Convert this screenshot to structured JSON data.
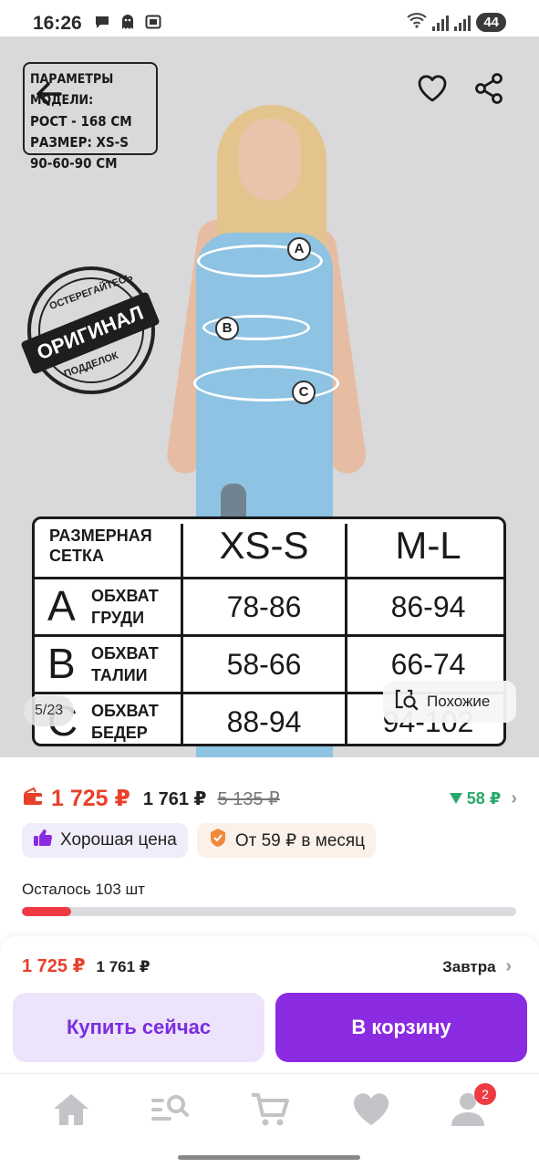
{
  "status_bar": {
    "time": "16:26",
    "battery": "44",
    "icons": [
      "chat-bubble-icon",
      "ghost-icon",
      "screenshot-icon",
      "wifi-icon",
      "signal-icon",
      "signal-roaming-icon"
    ]
  },
  "gallery": {
    "model_params": {
      "title": "ПАРАМЕТРЫ МОДЕЛИ:",
      "height": "РОСТ - 168 СМ",
      "size": "РАЗМЕР: XS-S",
      "measurements": "90-60-90 СМ"
    },
    "stamp": {
      "top_text": "ОСТЕРЕГАЙТЕСЬ",
      "banner": "ОРИГИНАЛ",
      "bottom_text": "ПОДДЕЛОК"
    },
    "measure_labels": [
      "A",
      "B",
      "C"
    ],
    "size_table": {
      "header": {
        "title": "РАЗМЕРНАЯ СЕТКА",
        "title_line1": "РАЗМЕРНАЯ",
        "title_line2": "СЕТКА",
        "col1": "XS-S",
        "col2": "M-L"
      },
      "rows": [
        {
          "letter": "A",
          "label_line1": "ОБХВАТ",
          "label_line2": "ГРУДИ",
          "v1": "78-86",
          "v2": "86-94"
        },
        {
          "letter": "B",
          "label_line1": "ОБХВАТ",
          "label_line2": "ТАЛИИ",
          "v1": "58-66",
          "v2": "66-74"
        },
        {
          "letter": "C",
          "label_line1": "ОБХВАТ",
          "label_line2": "БЕДЕР",
          "v1": "88-94",
          "v2": "94-102"
        }
      ]
    },
    "counter": "5/23",
    "similar_label": "Похожие"
  },
  "price": {
    "main": "1 725 ₽",
    "alt": "1 761 ₽",
    "old": "5 135 ₽",
    "drop": "58 ₽"
  },
  "badges": {
    "good_price": "Хорошая цена",
    "installment": "От 59 ₽ в месяц"
  },
  "stock": {
    "label": "Осталось 103 шт",
    "fill_percent": 10
  },
  "sheet": {
    "price_main": "1 725 ₽",
    "price_alt": "1 761 ₽",
    "delivery": "Завтра",
    "buy_now": "Купить сейчас",
    "add_to_cart": "В корзину"
  },
  "tabbar": {
    "items": [
      "home-icon",
      "catalog-search-icon",
      "cart-icon",
      "favorites-icon",
      "profile-icon"
    ],
    "profile_badge": "2"
  },
  "colors": {
    "accent_purple": "#8a2be2",
    "price_red": "#e8402a",
    "drop_green": "#2aa86a",
    "stock_red": "#ef3a44"
  }
}
